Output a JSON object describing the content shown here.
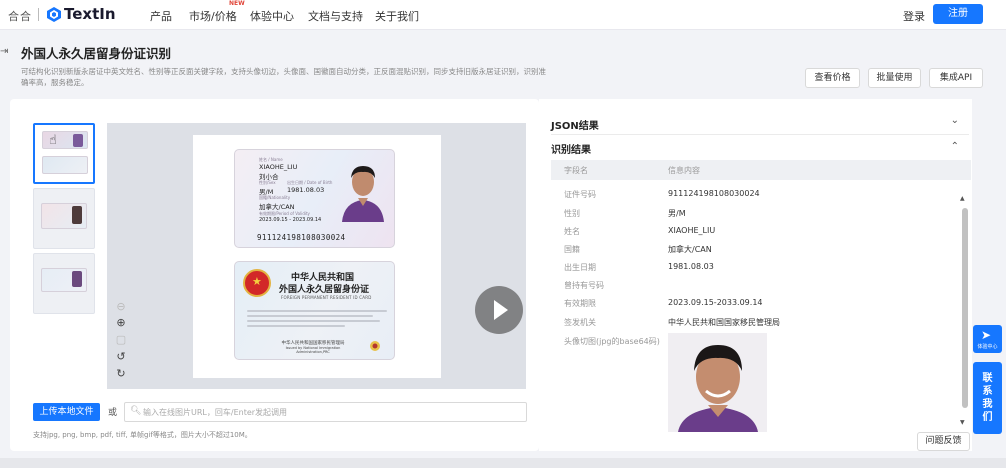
{
  "nav": {
    "brand_prefix": "合合",
    "brand_name": "TextIn",
    "items": [
      "产品",
      "市场/价格",
      "体验中心",
      "文档与支持",
      "关于我们"
    ],
    "new_badge": "NEW",
    "login": "登录",
    "register": "注册"
  },
  "header": {
    "title": "外国人永久居留身份证识别",
    "description": "可结构化识别新版永居证中英文姓名、性别等正反面关键字段，支持头像切边，头像面、国徽面自动分类，正反面混贴识别，同步支持旧版永居证识别，识别准确率高，服务稳定。",
    "buttons": [
      "查看价格",
      "批量使用",
      "集成API"
    ]
  },
  "card": {
    "front": {
      "name_label": "姓名 / Name",
      "name_en": "XIAOHE_LIU",
      "name_cn": "刘小合",
      "sex_label": "性别/Sex",
      "birth_label": "出生日期 / Date of Birth",
      "sex": "男/M",
      "birth": "1981.08.03",
      "nationality_label": "国籍/Nationality",
      "nationality": "加拿大/CAN",
      "period_label": "有效期限/Period of Validity",
      "period": "2023.09.15 - 2023.09.14",
      "number": "911124198108030024"
    },
    "back": {
      "title": "中华人民共和国",
      "title2": "外国人永久居留身份证",
      "subtitle": "FOREIGN PERMANENT RESIDENT ID CARD",
      "issuer_cn": "中华人民共和国国家移民管理局",
      "issuer_en": "Issued by National Immigration Administration,PRC"
    }
  },
  "upload": {
    "button": "上传本地文件",
    "or": "或",
    "placeholder": "输入在线图片URL，回车/Enter发起调用",
    "note": "支持jpg, png, bmp, pdf, tiff, 单帧gif等格式，图片大小不超过10M。"
  },
  "results": {
    "json_title": "JSON结果",
    "recog_title": "识别结果",
    "col_field": "字段名",
    "col_value": "信息内容",
    "rows": [
      {
        "k": "证件号码",
        "v": "911124198108030024"
      },
      {
        "k": "性别",
        "v": "男/M"
      },
      {
        "k": "姓名",
        "v": "XIAOHE_LIU"
      },
      {
        "k": "国籍",
        "v": "加拿大/CAN"
      },
      {
        "k": "出生日期",
        "v": "1981.08.03"
      },
      {
        "k": "曾持有号码",
        "v": ""
      },
      {
        "k": "有效期限",
        "v": "2023.09.15-2033.09.14"
      },
      {
        "k": "签发机关",
        "v": "中华人民共和国国家移民管理局"
      },
      {
        "k": "头像切图(jpg的base64码)",
        "v": ""
      }
    ],
    "feedback": "问题反馈"
  },
  "widgets": {
    "experience": "体验中心",
    "contact": [
      "联",
      "系",
      "我",
      "们"
    ]
  },
  "colors": {
    "primary": "#1677ff"
  }
}
